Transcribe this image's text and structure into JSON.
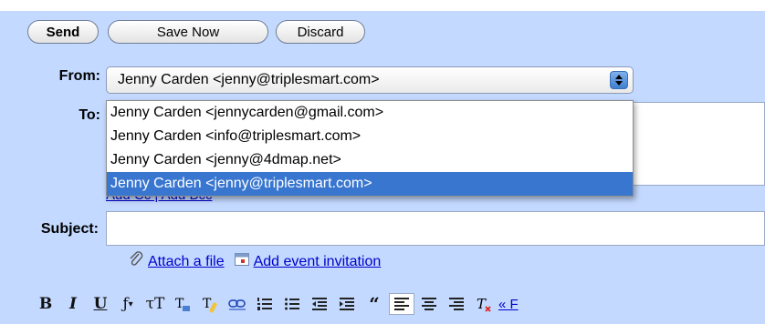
{
  "toolbar": {
    "send_label": "Send",
    "save_label": "Save Now",
    "discard_label": "Discard"
  },
  "from": {
    "label": "From:",
    "selected": "Jenny Carden <jenny@triplesmart.com>",
    "options": [
      "Jenny Carden <jennycarden@gmail.com>",
      "Jenny Carden <info@triplesmart.com>",
      "Jenny Carden <jenny@4dmap.net>",
      "Jenny Carden <jenny@triplesmart.com>"
    ]
  },
  "to": {
    "label": "To:",
    "value": ""
  },
  "cc_bcc": {
    "text": "Add Cc | Add Bcc"
  },
  "subject": {
    "label": "Subject:",
    "value": ""
  },
  "attachments": {
    "attach_label": "Attach a file",
    "event_label": "Add event invitation"
  },
  "format_toolbar": {
    "bold": "B",
    "italic": "I",
    "underline": "U",
    "font": "ƒ",
    "size": "τT",
    "more_link": "« F",
    "icons": [
      "bold-icon",
      "italic-icon",
      "underline-icon",
      "font-family-icon",
      "font-size-icon",
      "text-color-icon",
      "highlight-color-icon",
      "link-icon",
      "numbered-list-icon",
      "bulleted-list-icon",
      "indent-less-icon",
      "indent-more-icon",
      "quote-icon",
      "align-left-icon",
      "align-center-icon",
      "align-right-icon",
      "remove-formatting-icon"
    ]
  },
  "colors": {
    "compose_bg": "#c3d9ff",
    "selection": "#3876d0",
    "link": "#0000cc"
  }
}
